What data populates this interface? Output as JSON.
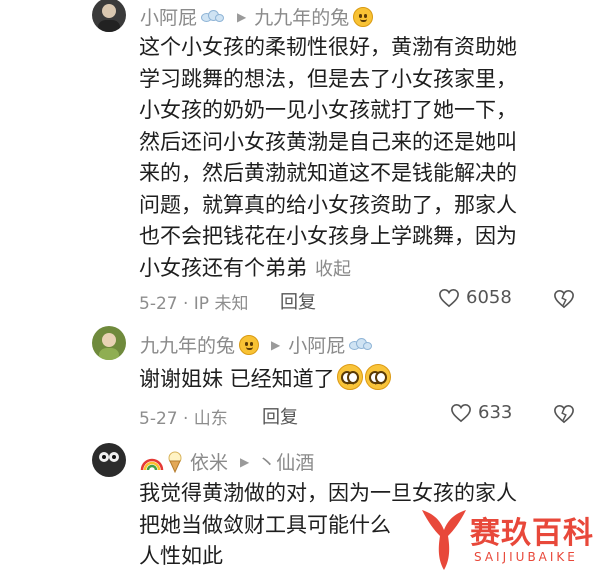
{
  "comments": [
    {
      "author": "小阿屁",
      "reply_to": "九九年的兔",
      "lines": [
        "这个小女孩的柔韧性很好，黄渤有资助她",
        "学习跳舞的想法，但是去了小女孩家里，",
        "小女孩的奶奶一见小女孩就打了她一下，",
        "然后还问小女孩黄渤是自己来的还是她叫",
        "来的，然后黄渤就知道这不是钱能解决的",
        "问题，就算真的给小女孩资助了，那家人",
        "也不会把钱花在小女孩身上学跳舞，因为",
        "小女孩还有个弟弟"
      ],
      "collapse_label": "收起",
      "meta": "5-27 · IP 未知",
      "reply_label": "回复",
      "likes": "6058"
    },
    {
      "author": "九九年的兔",
      "reply_to": "小阿屁",
      "lines": [
        "谢谢姐妹 已经知道了"
      ],
      "meta": "5-27 · 山东",
      "reply_label": "回复",
      "likes": "633"
    },
    {
      "author": "依米",
      "reply_to": "丶仙酒",
      "lines": [
        "我觉得黄渤做的对，因为一旦女孩的家人",
        "把她当做敛财工具可能什么",
        "人性如此"
      ]
    }
  ],
  "watermark": {
    "brand": "赛玖百科",
    "sub": "SAIJIUBAIKE"
  },
  "colors": {
    "accent_watermark": "#e8483a",
    "meta_gray": "#8d8d8d"
  },
  "icons": [
    "steam-puff-icon",
    "smile-emoji-icon",
    "pleading-emoji-icon",
    "heart-outline-icon",
    "broken-heart-icon",
    "rainbow-icon",
    "ice-cream-icon"
  ]
}
